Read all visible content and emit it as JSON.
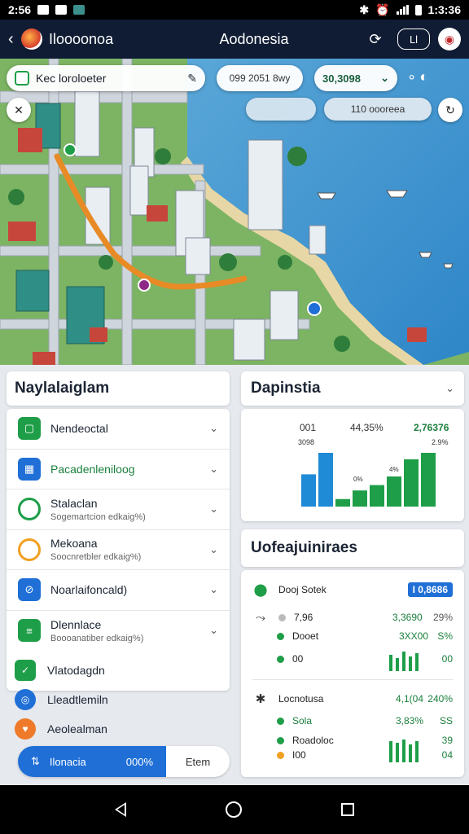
{
  "status_bar": {
    "time_left": "2:56",
    "time_right": "1:3:36"
  },
  "app_bar": {
    "app_name": "Iloooonoa",
    "center_title": "Aodonesia",
    "box_button": "Ll"
  },
  "map": {
    "search_text": "Kec loroloeter",
    "date_pill": "099 2051 8wy",
    "count_pill": "30,3098",
    "region_pill": "110 oooreea"
  },
  "left_panel": {
    "title": "Naylalaiglam",
    "items": [
      {
        "label": "Nendeoctal",
        "sub": "",
        "icon": "square-check-icon"
      },
      {
        "label": "Pacadenleniloog",
        "sub": "",
        "icon": "grid-icon"
      },
      {
        "label": "Stalaclan",
        "sub": "Sogemartcion edkaig%)",
        "icon": "ring-icon"
      },
      {
        "label": "Mekoana",
        "sub": "Soocnretbler edkaig%)",
        "icon": "ring-icon"
      },
      {
        "label": "Noarlaifoncald)",
        "sub": "",
        "icon": "map-icon"
      },
      {
        "label": "Dlennlace",
        "sub": "Boooanatiber edkaig%)",
        "icon": "document-icon"
      }
    ],
    "extras": [
      {
        "label": "Vlatodagdn"
      },
      {
        "label": "Lleadtlemiln"
      },
      {
        "label": "Aeolealman"
      }
    ],
    "bottom_tab": {
      "active_label": "Ilonacia",
      "active_value": "000%",
      "other_label": "Etem"
    }
  },
  "right_panel": {
    "title": "Dapinstia",
    "metrics": {
      "m1": "001",
      "m1_sub": "3098",
      "m2": "44,35%",
      "m3": "2,76376",
      "m3_sub": "2.9%",
      "bar_a": "0%",
      "bar_b": "4%"
    },
    "chart_data": {
      "type": "bar",
      "series": [
        {
          "color": "#1f8ad6",
          "values": [
            60,
            100,
            0,
            0,
            0,
            0,
            0,
            0
          ]
        },
        {
          "color": "#1e9e48",
          "values": [
            0,
            0,
            14,
            30,
            40,
            56,
            88,
            100
          ]
        }
      ]
    },
    "details_title": "Uofeajuiniraes",
    "details": {
      "row1_label": "Dooj Sotek",
      "row1_badge": "I 0,8686",
      "row2_label": "7,96",
      "row2_val": "3,3690",
      "row2_pct": "29%",
      "row3_label": "Dooet",
      "row3_val": "3XX00",
      "row3_pct": "S%",
      "row4_label": "00",
      "row4_pct": "00",
      "row5_label": "Locnotusa",
      "row5_val": "4,1(04",
      "row5_pct": "240%",
      "row6_label": "Sola",
      "row6_val": "3,83%",
      "row6_pct": "SS",
      "row7_label": "Roadoloc",
      "row7_pct": "39",
      "row8_label": "I00",
      "row8_pct": "04"
    }
  }
}
